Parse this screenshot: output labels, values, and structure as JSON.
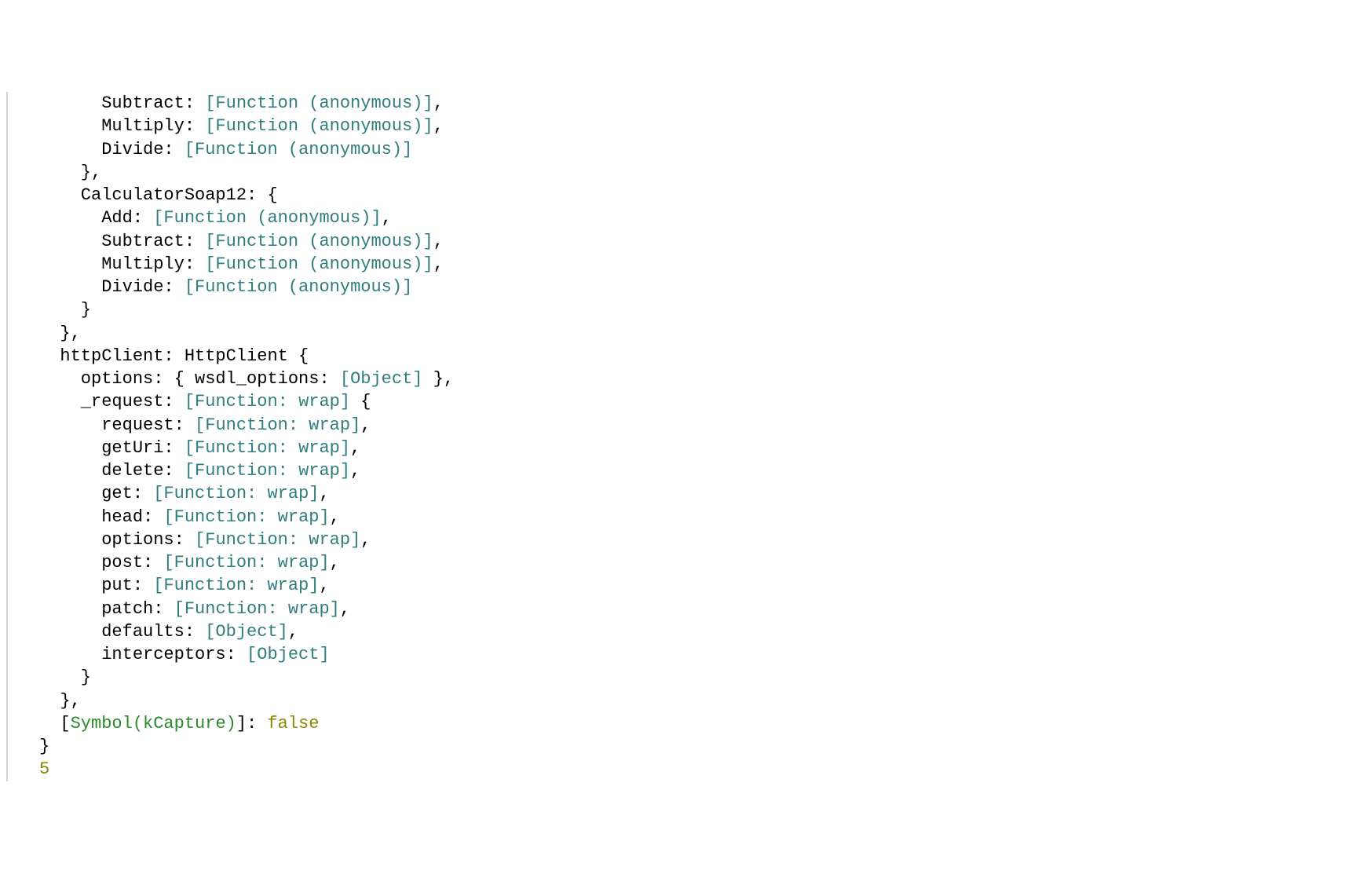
{
  "tokens": {
    "funcAnon": "[Function (anonymous)]",
    "funcWrap": "[Function: wrap]",
    "object": "[Object]",
    "symbolKCapture": "Symbol(kCapture)",
    "false": "false",
    "five": "5"
  },
  "lines": {
    "l1_prefix": "      Subtract: ",
    "l1_suffix": ",",
    "l2_prefix": "      Multiply: ",
    "l2_suffix": ",",
    "l3_prefix": "      Divide: ",
    "l4": "    },",
    "l5": "    CalculatorSoap12: {",
    "l6_prefix": "      Add: ",
    "l6_suffix": ",",
    "l7_prefix": "      Subtract: ",
    "l7_suffix": ",",
    "l8_prefix": "      Multiply: ",
    "l8_suffix": ",",
    "l9_prefix": "      Divide: ",
    "l10": "    }",
    "l11": "  },",
    "l12": "  httpClient: HttpClient {",
    "l13_prefix": "    options: { wsdl_options: ",
    "l13_suffix": " },",
    "l14_prefix": "    _request: ",
    "l14_suffix": " {",
    "l15_prefix": "      request: ",
    "l15_suffix": ",",
    "l16_prefix": "      getUri: ",
    "l16_suffix": ",",
    "l17_prefix": "      delete: ",
    "l17_suffix": ",",
    "l18_prefix": "      get: ",
    "l18_suffix": ",",
    "l19_prefix": "      head: ",
    "l19_suffix": ",",
    "l20_prefix": "      options: ",
    "l20_suffix": ",",
    "l21_prefix": "      post: ",
    "l21_suffix": ",",
    "l22_prefix": "      put: ",
    "l22_suffix": ",",
    "l23_prefix": "      patch: ",
    "l23_suffix": ",",
    "l24_prefix": "      defaults: ",
    "l24_suffix": ",",
    "l25_prefix": "      interceptors: ",
    "l26": "    }",
    "l27": "  },",
    "l28_prefix": "  [",
    "l28_mid": "]: ",
    "l29": "}"
  }
}
